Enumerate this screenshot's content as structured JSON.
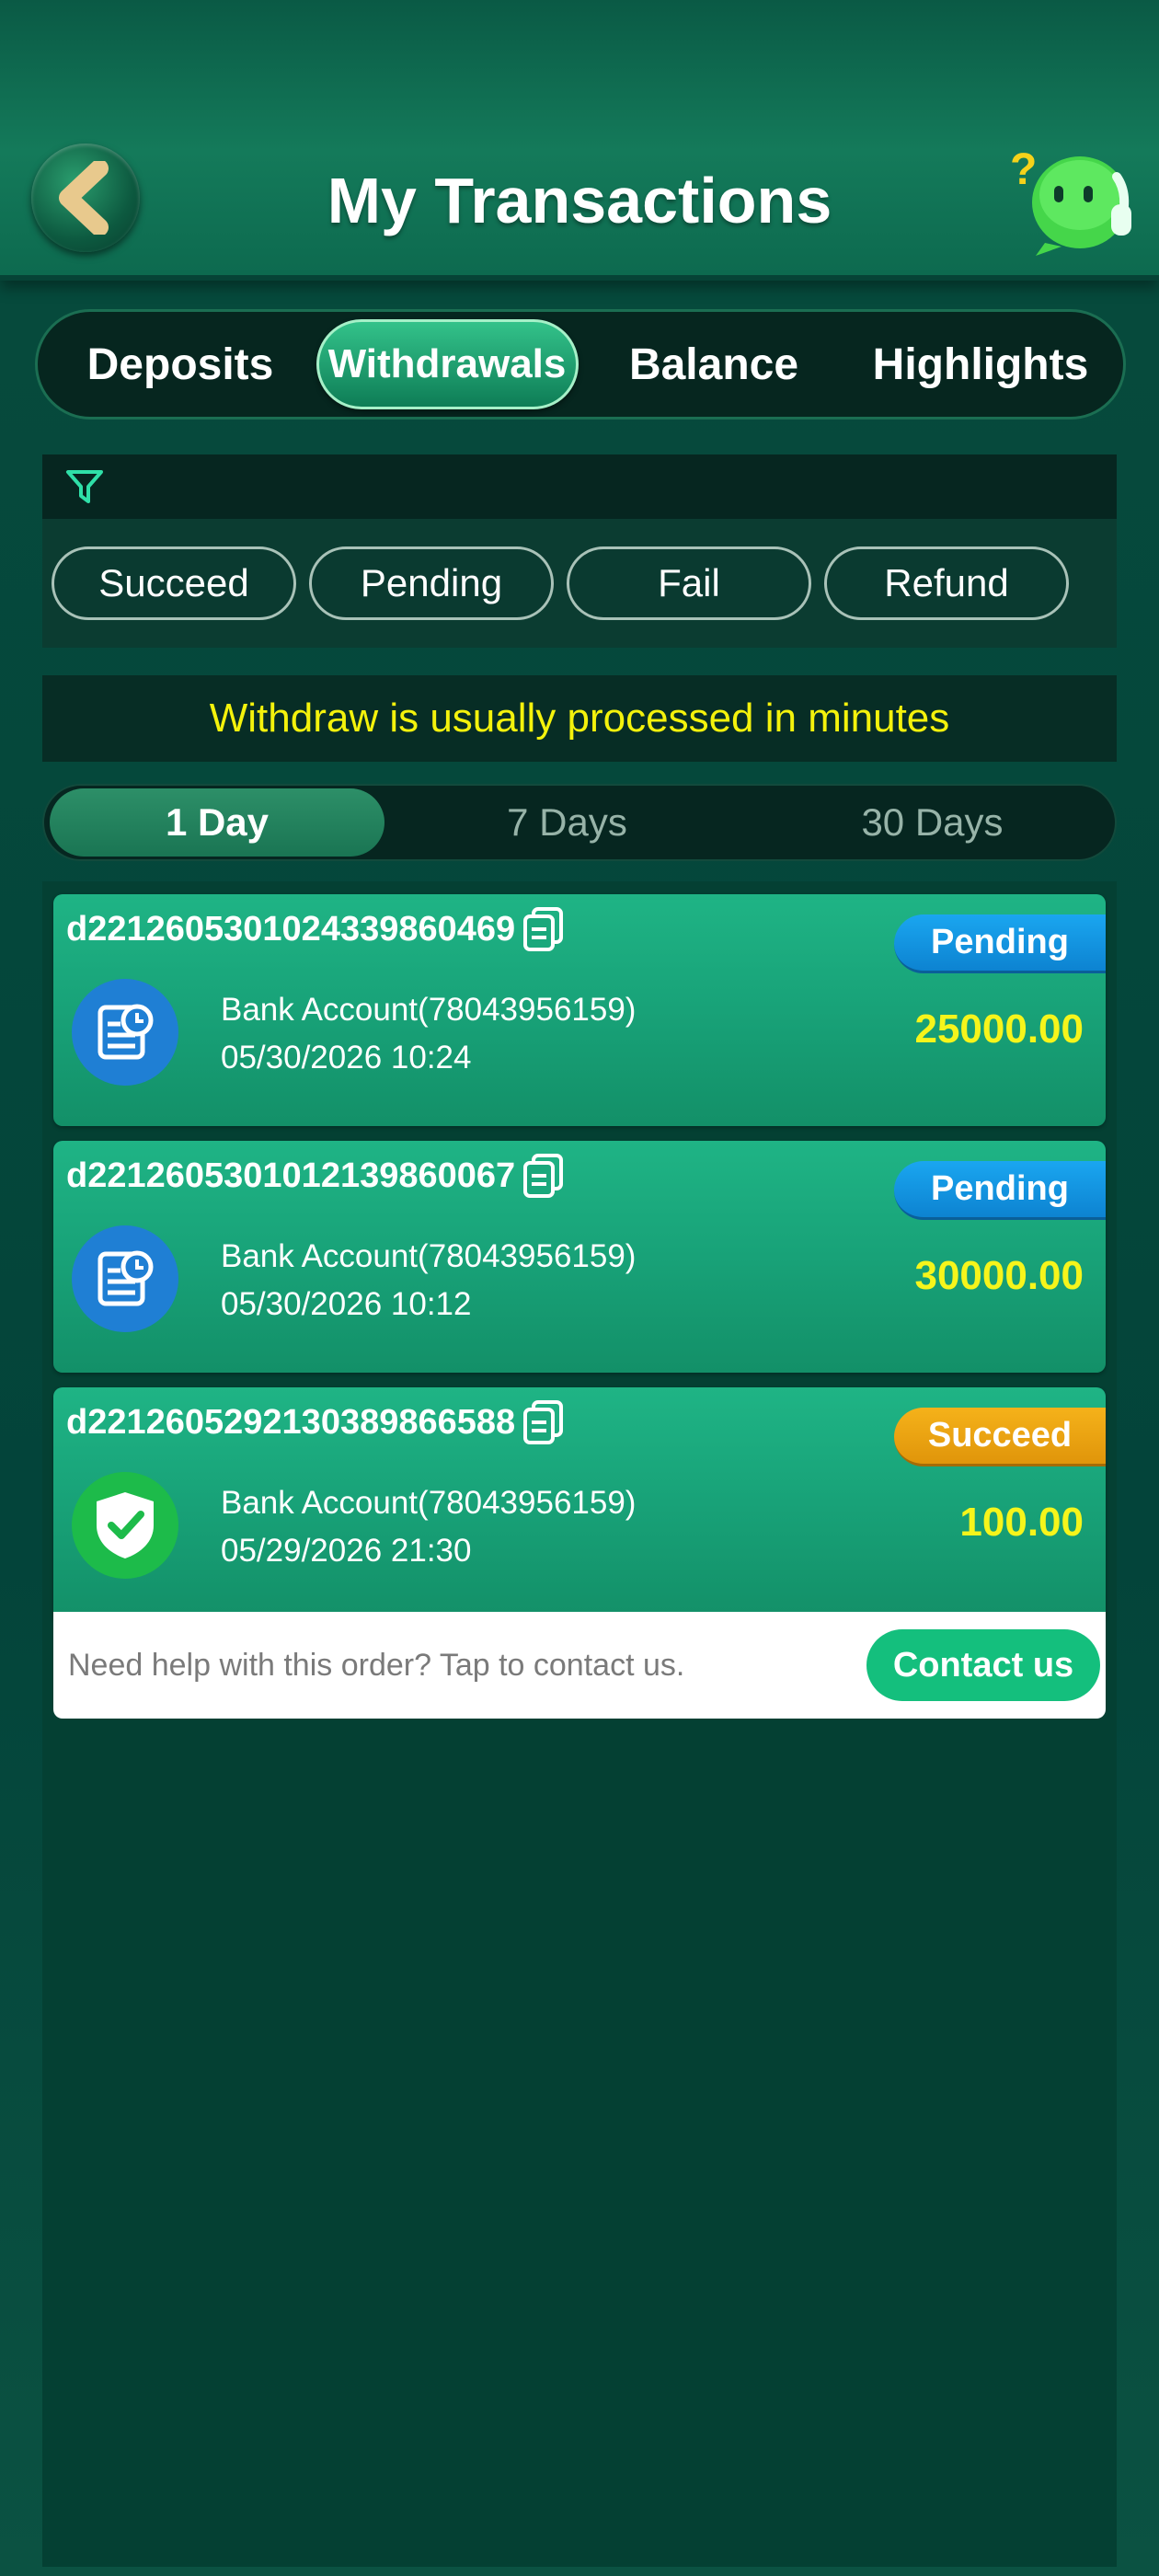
{
  "header": {
    "title": "My Transactions",
    "back_icon": "chevron-left-icon",
    "help_icon": "support-mascot-icon"
  },
  "tabs": [
    {
      "label": "Deposits",
      "active": false
    },
    {
      "label": "Withdrawals",
      "active": true
    },
    {
      "label": "Balance",
      "active": false
    },
    {
      "label": "Highlights",
      "active": false
    }
  ],
  "filter": {
    "icon": "filter-icon",
    "chips": [
      "Succeed",
      "Pending",
      "Fail",
      "Refund"
    ]
  },
  "notice": "Withdraw is usually processed in minutes",
  "days": [
    {
      "label": "1 Day",
      "active": true
    },
    {
      "label": "7 Days",
      "active": false
    },
    {
      "label": "30 Days",
      "active": false
    }
  ],
  "transactions": [
    {
      "order_id": "d2212605301024339860469",
      "status": "Pending",
      "account": "Bank Account(78043956159)",
      "datetime": "05/30/2026 10:24",
      "amount": "25000.00"
    },
    {
      "order_id": "d2212605301012139860067",
      "status": "Pending",
      "account": "Bank Account(78043956159)",
      "datetime": "05/30/2026 10:12",
      "amount": "30000.00"
    },
    {
      "order_id": "d2212605292130389866588",
      "status": "Succeed",
      "account": "Bank Account(78043956159)",
      "datetime": "05/29/2026 21:30",
      "amount": "100.00"
    }
  ],
  "help": {
    "text": "Need help with this order? Tap to contact us.",
    "button": "Contact us"
  },
  "colors": {
    "accent_green": "#14bf7d",
    "amount_yellow": "#f6f51b",
    "pending_blue": "#0d83d1",
    "succeed_orange": "#e0950a"
  }
}
